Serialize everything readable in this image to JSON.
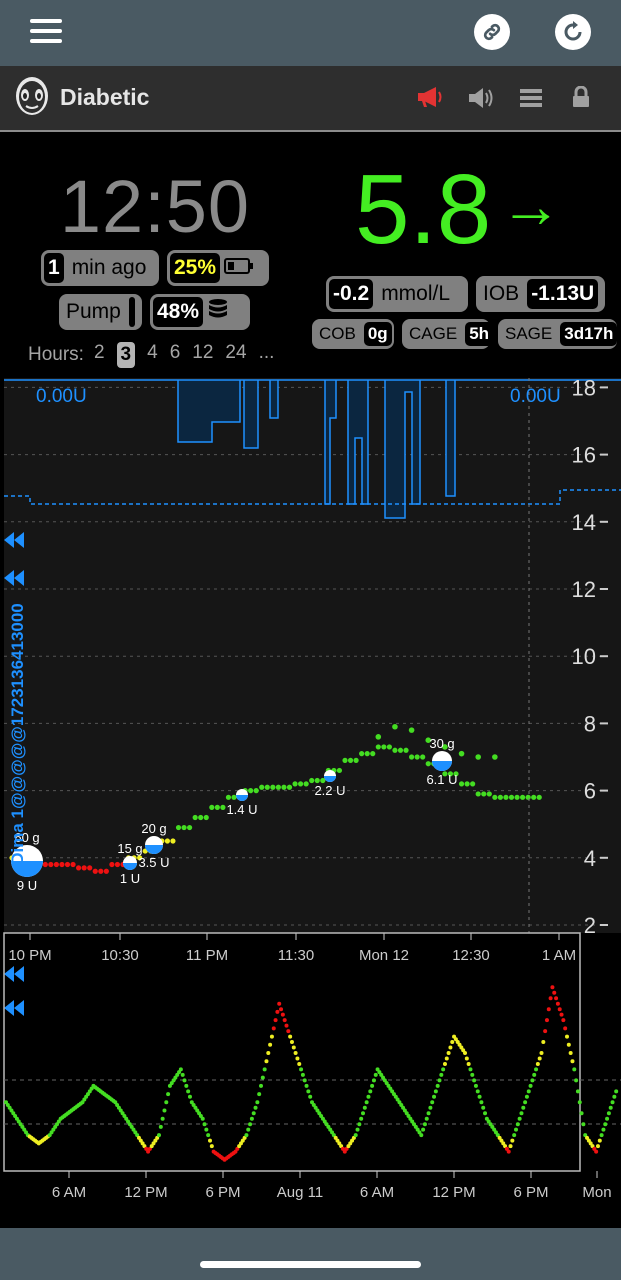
{
  "app": {
    "title": "Diabetic"
  },
  "top_icons": [
    "hamburger-menu-icon",
    "link-icon",
    "refresh-icon"
  ],
  "appbar_icons": [
    "alarm-megaphone-icon",
    "volume-icon",
    "list-menu-icon",
    "lock-icon"
  ],
  "status": {
    "time": "12:50",
    "ago_value": "1",
    "ago_label": "min ago",
    "battery_pct": "25%",
    "pump_label": "Pump",
    "reservoir_pct": "48%",
    "bg": "5.8",
    "trend_arrow": "→",
    "delta_value": "-0.2",
    "delta_unit": "mmol/L",
    "iob_label": "IOB",
    "iob_value": "-1.13U",
    "cob_label": "COB",
    "cob_value": "0g",
    "cage_label": "CAGE",
    "cage_value": "5h",
    "sage_label": "SAGE",
    "sage_value": "3d17h"
  },
  "hours": {
    "label": "Hours:",
    "options": [
      "2",
      "3",
      "4",
      "6",
      "12",
      "24",
      "..."
    ],
    "selected": "3"
  },
  "colors": {
    "accent_green": "#44ee22",
    "in_range": "#44dd22",
    "warn": "#eeee22",
    "low_high": "#ee1111",
    "basal": "#1e90ff",
    "battery_warn": "#ffff33",
    "alarm_red": "#e33333"
  },
  "side_label": "Dima 1@@@@@1723136413000",
  "chart_data": [
    {
      "type": "scatter",
      "x_ticks": [
        "10 PM",
        "10:30",
        "11 PM",
        "11:30",
        "Mon 12",
        "12:30",
        "1 AM"
      ],
      "y_ticks": [
        "2",
        "4",
        "6",
        "8",
        "10",
        "12",
        "14",
        "16",
        "18"
      ],
      "ylim": [
        1,
        19
      ],
      "basal_left": "0.00U",
      "basal_right": "0.00U",
      "treatments": [
        {
          "carbs": "60 g",
          "insulin": "9 U"
        },
        {
          "carbs": "15 g",
          "insulin": "1 U"
        },
        {
          "carbs": "20 g",
          "insulin": "3.5 U"
        },
        {
          "insulin": "1.4 U"
        },
        {
          "insulin": "2.2 U"
        },
        {
          "carbs": "30 g",
          "insulin": "6.1 U"
        }
      ],
      "series_in_range": [
        [
          0,
          4.0
        ],
        [
          3,
          3.9
        ],
        [
          6,
          3.8
        ],
        [
          9,
          3.8
        ],
        [
          12,
          3.7
        ],
        [
          15,
          3.6
        ],
        [
          18,
          3.8
        ],
        [
          21,
          4.0
        ],
        [
          24,
          4.2
        ],
        [
          27,
          4.5
        ],
        [
          30,
          4.9
        ],
        [
          33,
          5.2
        ],
        [
          36,
          5.5
        ],
        [
          39,
          5.8
        ],
        [
          42,
          6.0
        ],
        [
          45,
          6.1
        ],
        [
          48,
          6.1
        ],
        [
          51,
          6.2
        ],
        [
          54,
          6.3
        ],
        [
          57,
          6.6
        ],
        [
          60,
          6.9
        ],
        [
          63,
          7.1
        ],
        [
          66,
          7.3
        ],
        [
          69,
          7.2
        ],
        [
          72,
          7.0
        ],
        [
          75,
          6.8
        ],
        [
          78,
          6.5
        ],
        [
          81,
          6.2
        ],
        [
          84,
          5.9
        ],
        [
          87,
          5.8
        ],
        [
          90,
          5.8
        ],
        [
          93,
          5.8
        ]
      ],
      "series_predicted": [
        [
          66,
          7.6
        ],
        [
          69,
          7.9
        ],
        [
          72,
          7.8
        ],
        [
          75,
          7.5
        ],
        [
          78,
          7.3
        ],
        [
          81,
          7.1
        ],
        [
          84,
          7.0
        ],
        [
          87,
          7.0
        ]
      ]
    },
    {
      "type": "line",
      "x_ticks": [
        "6 AM",
        "12 PM",
        "6 PM",
        "Aug 11",
        "6 AM",
        "12 PM",
        "6 PM",
        "Mon"
      ],
      "ylim": [
        2,
        16
      ],
      "values": [
        6,
        5,
        4,
        3.5,
        4,
        5,
        5.5,
        6,
        7,
        6.5,
        6,
        5,
        4,
        3,
        4,
        7,
        8,
        6,
        5,
        3,
        2.5,
        3,
        4,
        6,
        9,
        12,
        10,
        8,
        6,
        5,
        4,
        3,
        4,
        6,
        8,
        7,
        6,
        5,
        4,
        6,
        8,
        10,
        9,
        7,
        5,
        4,
        3,
        5,
        7,
        9,
        13,
        11,
        8,
        4,
        3,
        5,
        7
      ]
    }
  ]
}
